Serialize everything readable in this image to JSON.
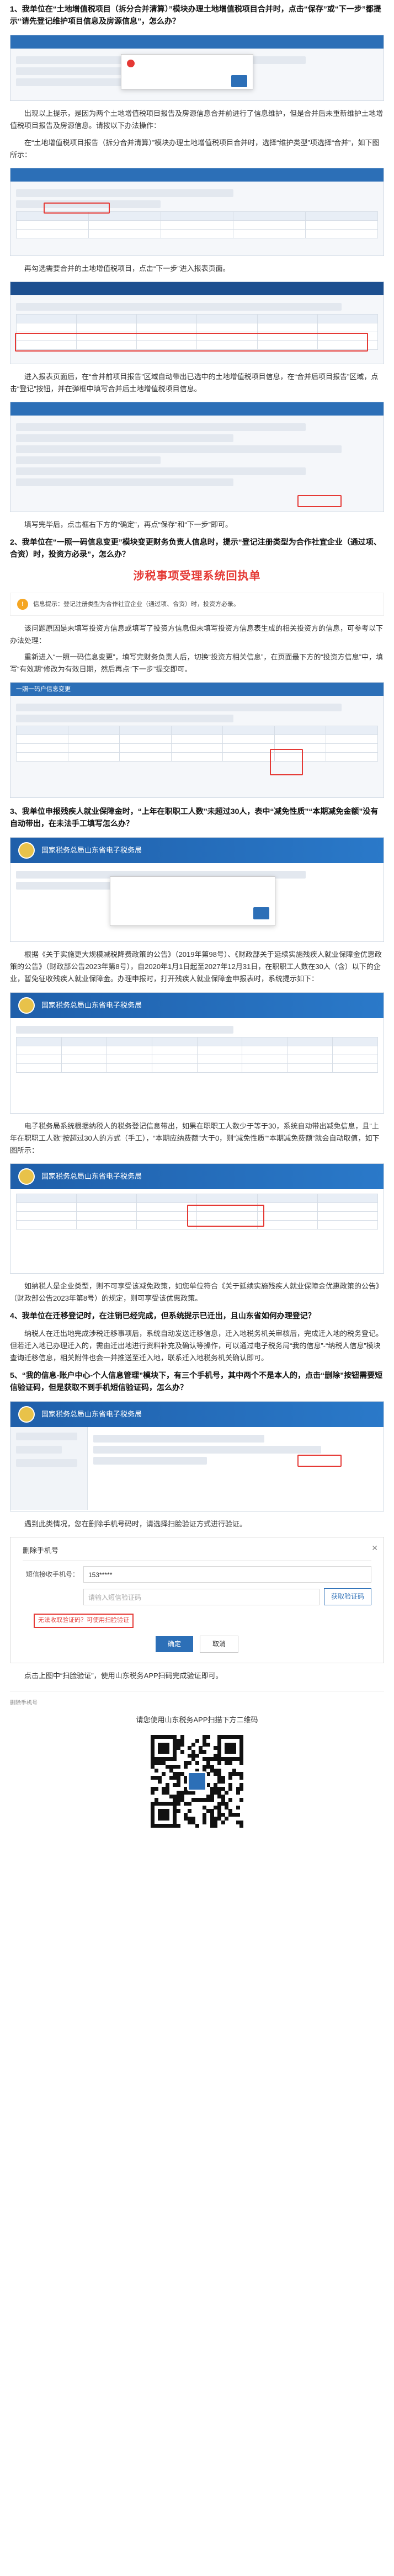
{
  "q1": {
    "title": "1、我单位在“土地增值税项目（拆分合并清算）”模块办理土地增值税项目合并时，点击“保存”或“下一步”都提示“请先登记维护项目信息及房源信息”，怎么办？",
    "answer1": "出现以上提示，是因为两个土地增值税项目报告及房源信息合并前进行了信息维护，但是合并后未重新维护土地增值税项目报告及房源信息。请按以下办法操作：",
    "answer2": "在“土地增值税项目报告（拆分合并清算）”模块办理土地增值税项目合并时，选择“维护类型”项选择“合并”，如下图所示：",
    "caption1": "再勾选需要合并的土地增值税项目，点击“下一步”进入报表页面。",
    "caption2": "进入报表页面后，在“合并前项目报告”区域自动带出已选中的土地增值税项目信息，在“合并后项目报告”区域，点击“登记”按钮，并在弹框中填写合并后土地增值税项目信息。",
    "caption3": "填写完毕后，点击框右下方的“确定”，再点“保存”和“下一步”即可。"
  },
  "q2": {
    "title": "2、我单位在“一照一码信息变更”模块变更财务负责人信息时，提示“登记注册类型为合作社宜企业（通过项、合资）时，投资方必录”，怎么办？",
    "banner": "涉税事项受理系统回执单",
    "notice_text": "信息提示：登记注册类型为合作社宜企业（通过项、合资）时，投资方必录。",
    "answer1": "该问题原因是未填写投资方信息或填写了投资方信息但未填写投资方信息表生成的相关投资方的信息，可参考以下办法处理：",
    "answer2": "重新进入“一照一码信息变更”，填写完财务负责人后，切换“投资方相关信息”，在页面最下方的“投资方信息”中，填写“有效期”修改为有效日期，然后再点“下一步”提交即可。",
    "screen_title": "一照一码户信息变更"
  },
  "q3": {
    "title": "3、我单位申报残疾人就业保障金时，“上年在职职工人数”未超过30人，表中“减免性质”“本期减免金额”没有自动带出，在未法手工填写怎么办？",
    "answer1": "根据《关于实施更大规模减税降费政策的公告》（2019年第98号）、《财政部关于延续实施残疾人就业保障金优惠政策的公告》（财政部公告2023年第8号），自2020年1月1日起至2027年12月31日，在职职工人数在30人（含）以下的企业，暂免征收残疾人就业保障金。办理申报时，打开残疾人就业保障金申报表时，系统提示如下：",
    "answer2": "电子税务局系统根据纳税人的税务登记信息带出，如果在职职工人数少于等于30，系统自动带出减免信息，且“上年在职职工人数”按超过30人的方式（手工），“本期应纳费额”大于0，则“减免性质”“本期减免费额”就会自动取值，如下图所示：",
    "answer3": "如纳税人是企业类型，则不可享受该减免政策，如您单位符合《关于延续实施残疾人就业保障金优惠政策的公告》（财政部公告2023年第8号）的规定，则可享受该优惠政策。",
    "portal_title": "国家税务总局山东省电子税务局"
  },
  "q4": {
    "title": "4、我单位在迁移登记时，在注销已经完成，但系统提示已迁出，且山东省如何办理登记？",
    "answer1": "纳税人在迁出地完成涉税迁移事项后，系统自动发送迁移信息，迁入地税务机关审核后，完成迁入地的税务登记。但若迁入地已办理迁入的，需由迁出地进行资料补充及确认等操作，可以通过电子税务局“我的信息”-“纳税人信息”模块查询迁移信息，相关附件也会一并推送至迁入地，联系迁入地税务机关确认即可。"
  },
  "q5": {
    "title": "5、“我的信息-账户中心-个人信息管理”模块下，有三个手机号，其中两个不是本人的，点击“删除”按钮需要短信验证码，但是获取不到手机短信验证码，怎么办？",
    "answer1": "遇到此类情况，您在删除手机号码时，请选择扫脸验证方式进行验证。",
    "modal_title": "删除手机号",
    "phone_label": "短信接收手机号：",
    "phone_value": "153*****",
    "code_label": "",
    "code_placeholder": "请输入短信验证码",
    "code_button": "获取验证码",
    "warn_text": "无法收取验证码？可使用扫脸验证",
    "ok": "确定",
    "cancel": "取消",
    "answer2": "点击上图中“扫脸验证”，使用山东税务APP扫码完成验证即可。"
  },
  "footer": {
    "breadcrumb": "删除手机号",
    "qr_caption": "请您使用山东税务APP扫描下方二维码"
  },
  "colors": {
    "accent": "#2c6fb7",
    "alert": "#e53935"
  }
}
